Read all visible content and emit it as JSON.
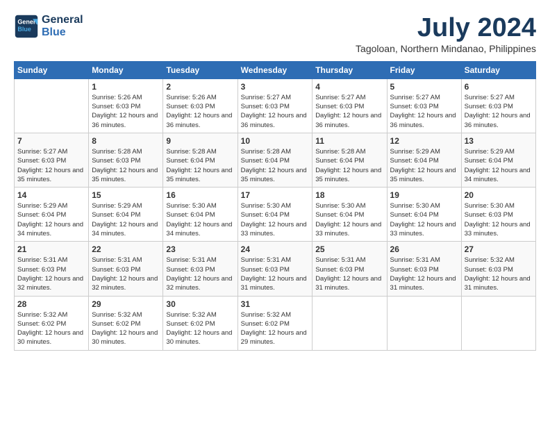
{
  "header": {
    "logo_line1": "General",
    "logo_line2": "Blue",
    "month_title": "July 2024",
    "location": "Tagoloan, Northern Mindanao, Philippines"
  },
  "weekdays": [
    "Sunday",
    "Monday",
    "Tuesday",
    "Wednesday",
    "Thursday",
    "Friday",
    "Saturday"
  ],
  "weeks": [
    [
      {
        "day": "",
        "sunrise": "",
        "sunset": "",
        "daylight": ""
      },
      {
        "day": "1",
        "sunrise": "Sunrise: 5:26 AM",
        "sunset": "Sunset: 6:03 PM",
        "daylight": "Daylight: 12 hours and 36 minutes."
      },
      {
        "day": "2",
        "sunrise": "Sunrise: 5:26 AM",
        "sunset": "Sunset: 6:03 PM",
        "daylight": "Daylight: 12 hours and 36 minutes."
      },
      {
        "day": "3",
        "sunrise": "Sunrise: 5:27 AM",
        "sunset": "Sunset: 6:03 PM",
        "daylight": "Daylight: 12 hours and 36 minutes."
      },
      {
        "day": "4",
        "sunrise": "Sunrise: 5:27 AM",
        "sunset": "Sunset: 6:03 PM",
        "daylight": "Daylight: 12 hours and 36 minutes."
      },
      {
        "day": "5",
        "sunrise": "Sunrise: 5:27 AM",
        "sunset": "Sunset: 6:03 PM",
        "daylight": "Daylight: 12 hours and 36 minutes."
      },
      {
        "day": "6",
        "sunrise": "Sunrise: 5:27 AM",
        "sunset": "Sunset: 6:03 PM",
        "daylight": "Daylight: 12 hours and 36 minutes."
      }
    ],
    [
      {
        "day": "7",
        "sunrise": "Sunrise: 5:27 AM",
        "sunset": "Sunset: 6:03 PM",
        "daylight": "Daylight: 12 hours and 35 minutes."
      },
      {
        "day": "8",
        "sunrise": "Sunrise: 5:28 AM",
        "sunset": "Sunset: 6:03 PM",
        "daylight": "Daylight: 12 hours and 35 minutes."
      },
      {
        "day": "9",
        "sunrise": "Sunrise: 5:28 AM",
        "sunset": "Sunset: 6:04 PM",
        "daylight": "Daylight: 12 hours and 35 minutes."
      },
      {
        "day": "10",
        "sunrise": "Sunrise: 5:28 AM",
        "sunset": "Sunset: 6:04 PM",
        "daylight": "Daylight: 12 hours and 35 minutes."
      },
      {
        "day": "11",
        "sunrise": "Sunrise: 5:28 AM",
        "sunset": "Sunset: 6:04 PM",
        "daylight": "Daylight: 12 hours and 35 minutes."
      },
      {
        "day": "12",
        "sunrise": "Sunrise: 5:29 AM",
        "sunset": "Sunset: 6:04 PM",
        "daylight": "Daylight: 12 hours and 35 minutes."
      },
      {
        "day": "13",
        "sunrise": "Sunrise: 5:29 AM",
        "sunset": "Sunset: 6:04 PM",
        "daylight": "Daylight: 12 hours and 34 minutes."
      }
    ],
    [
      {
        "day": "14",
        "sunrise": "Sunrise: 5:29 AM",
        "sunset": "Sunset: 6:04 PM",
        "daylight": "Daylight: 12 hours and 34 minutes."
      },
      {
        "day": "15",
        "sunrise": "Sunrise: 5:29 AM",
        "sunset": "Sunset: 6:04 PM",
        "daylight": "Daylight: 12 hours and 34 minutes."
      },
      {
        "day": "16",
        "sunrise": "Sunrise: 5:30 AM",
        "sunset": "Sunset: 6:04 PM",
        "daylight": "Daylight: 12 hours and 34 minutes."
      },
      {
        "day": "17",
        "sunrise": "Sunrise: 5:30 AM",
        "sunset": "Sunset: 6:04 PM",
        "daylight": "Daylight: 12 hours and 33 minutes."
      },
      {
        "day": "18",
        "sunrise": "Sunrise: 5:30 AM",
        "sunset": "Sunset: 6:04 PM",
        "daylight": "Daylight: 12 hours and 33 minutes."
      },
      {
        "day": "19",
        "sunrise": "Sunrise: 5:30 AM",
        "sunset": "Sunset: 6:04 PM",
        "daylight": "Daylight: 12 hours and 33 minutes."
      },
      {
        "day": "20",
        "sunrise": "Sunrise: 5:30 AM",
        "sunset": "Sunset: 6:03 PM",
        "daylight": "Daylight: 12 hours and 33 minutes."
      }
    ],
    [
      {
        "day": "21",
        "sunrise": "Sunrise: 5:31 AM",
        "sunset": "Sunset: 6:03 PM",
        "daylight": "Daylight: 12 hours and 32 minutes."
      },
      {
        "day": "22",
        "sunrise": "Sunrise: 5:31 AM",
        "sunset": "Sunset: 6:03 PM",
        "daylight": "Daylight: 12 hours and 32 minutes."
      },
      {
        "day": "23",
        "sunrise": "Sunrise: 5:31 AM",
        "sunset": "Sunset: 6:03 PM",
        "daylight": "Daylight: 12 hours and 32 minutes."
      },
      {
        "day": "24",
        "sunrise": "Sunrise: 5:31 AM",
        "sunset": "Sunset: 6:03 PM",
        "daylight": "Daylight: 12 hours and 31 minutes."
      },
      {
        "day": "25",
        "sunrise": "Sunrise: 5:31 AM",
        "sunset": "Sunset: 6:03 PM",
        "daylight": "Daylight: 12 hours and 31 minutes."
      },
      {
        "day": "26",
        "sunrise": "Sunrise: 5:31 AM",
        "sunset": "Sunset: 6:03 PM",
        "daylight": "Daylight: 12 hours and 31 minutes."
      },
      {
        "day": "27",
        "sunrise": "Sunrise: 5:32 AM",
        "sunset": "Sunset: 6:03 PM",
        "daylight": "Daylight: 12 hours and 31 minutes."
      }
    ],
    [
      {
        "day": "28",
        "sunrise": "Sunrise: 5:32 AM",
        "sunset": "Sunset: 6:02 PM",
        "daylight": "Daylight: 12 hours and 30 minutes."
      },
      {
        "day": "29",
        "sunrise": "Sunrise: 5:32 AM",
        "sunset": "Sunset: 6:02 PM",
        "daylight": "Daylight: 12 hours and 30 minutes."
      },
      {
        "day": "30",
        "sunrise": "Sunrise: 5:32 AM",
        "sunset": "Sunset: 6:02 PM",
        "daylight": "Daylight: 12 hours and 30 minutes."
      },
      {
        "day": "31",
        "sunrise": "Sunrise: 5:32 AM",
        "sunset": "Sunset: 6:02 PM",
        "daylight": "Daylight: 12 hours and 29 minutes."
      },
      {
        "day": "",
        "sunrise": "",
        "sunset": "",
        "daylight": ""
      },
      {
        "day": "",
        "sunrise": "",
        "sunset": "",
        "daylight": ""
      },
      {
        "day": "",
        "sunrise": "",
        "sunset": "",
        "daylight": ""
      }
    ]
  ]
}
